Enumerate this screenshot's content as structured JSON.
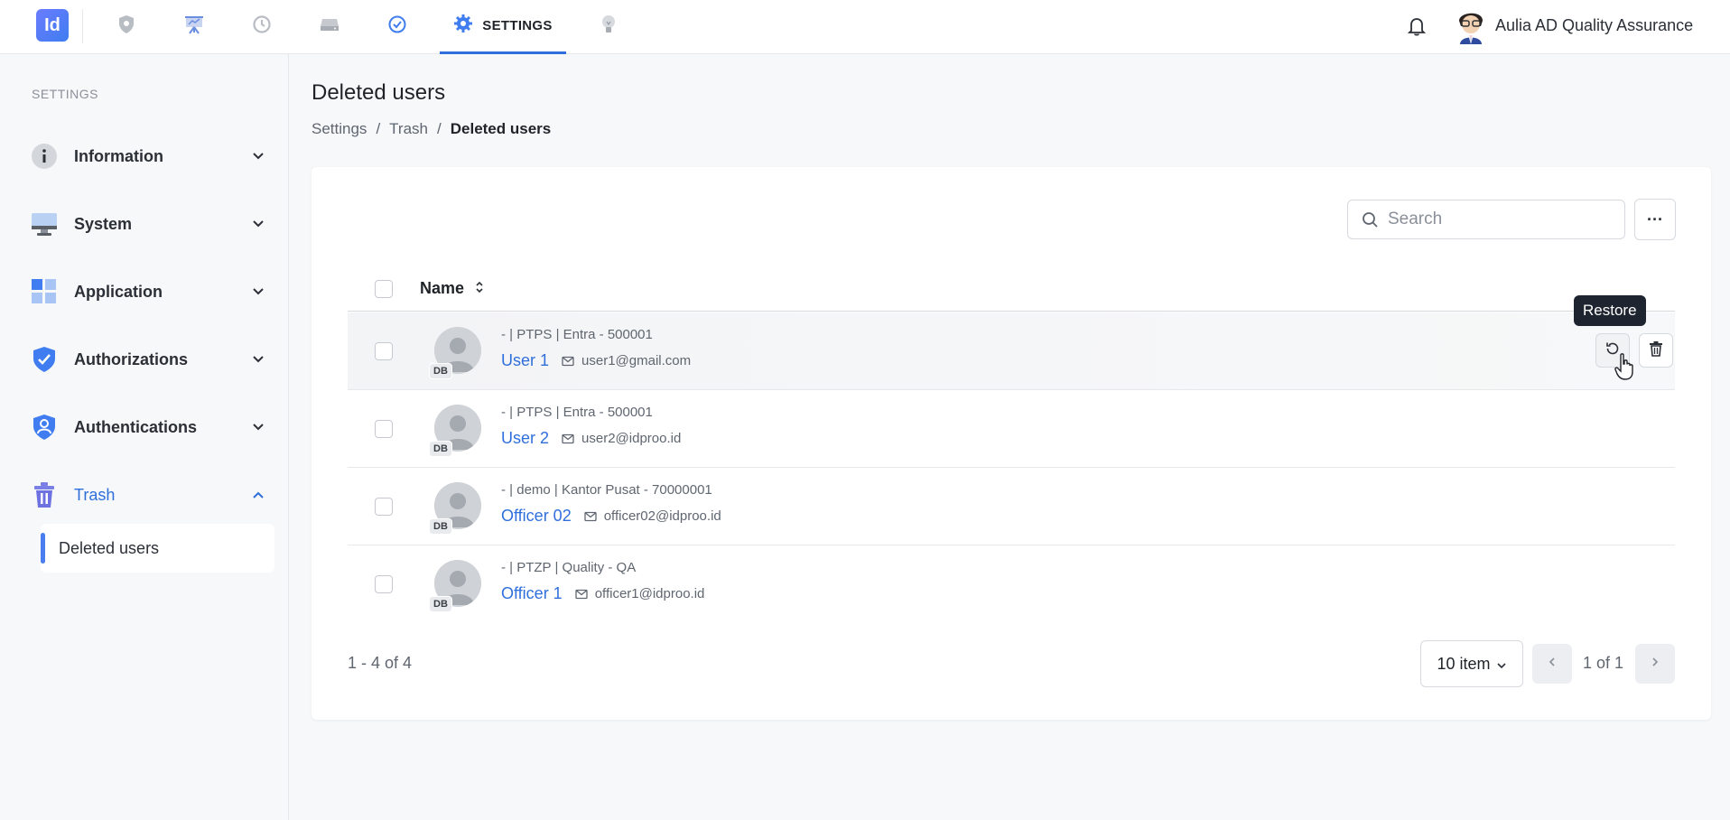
{
  "topbar": {
    "logo_text": "Id",
    "nav_icons": [
      "shield-icon",
      "presentation-icon",
      "history-icon",
      "drive-icon",
      "check-circle-icon",
      "lightbulb-icon"
    ],
    "active_tab": "SETTINGS",
    "user_name": "Aulia AD Quality Assurance"
  },
  "sidebar": {
    "title": "SETTINGS",
    "items": [
      {
        "label": "Information",
        "icon": "info-icon"
      },
      {
        "label": "System",
        "icon": "monitor-icon"
      },
      {
        "label": "Application",
        "icon": "grid-icon"
      },
      {
        "label": "Authorizations",
        "icon": "shield-check-icon"
      },
      {
        "label": "Authentications",
        "icon": "shield-user-icon"
      },
      {
        "label": "Trash",
        "icon": "trash-icon"
      }
    ],
    "sub_item": "Deleted users"
  },
  "main": {
    "title": "Deleted users",
    "breadcrumb": [
      "Settings",
      "/",
      "Trash",
      "/",
      "Deleted users"
    ],
    "search_placeholder": "Search",
    "more_label": "···",
    "column_name": "Name",
    "tooltip": "Restore",
    "rows": [
      {
        "meta": "- | PTPS | Entra - 500001",
        "name": "User 1",
        "email": "user1@gmail.com",
        "badge": "DB"
      },
      {
        "meta": "- | PTPS | Entra - 500001",
        "name": "User 2",
        "email": "user2@idproo.id",
        "badge": "DB"
      },
      {
        "meta": "- | demo | Kantor Pusat - 70000001",
        "name": "Officer 02",
        "email": "officer02@idproo.id",
        "badge": "DB"
      },
      {
        "meta": "- | PTZP | Quality - QA",
        "name": "Officer 1",
        "email": "officer1@idproo.id",
        "badge": "DB"
      }
    ],
    "count_text": "1 - 4 of 4",
    "page_size": "10 item",
    "page_text": "1 of 1"
  },
  "colors": {
    "accent": "#2f6fdc",
    "tooltip_bg": "#1e2530"
  }
}
